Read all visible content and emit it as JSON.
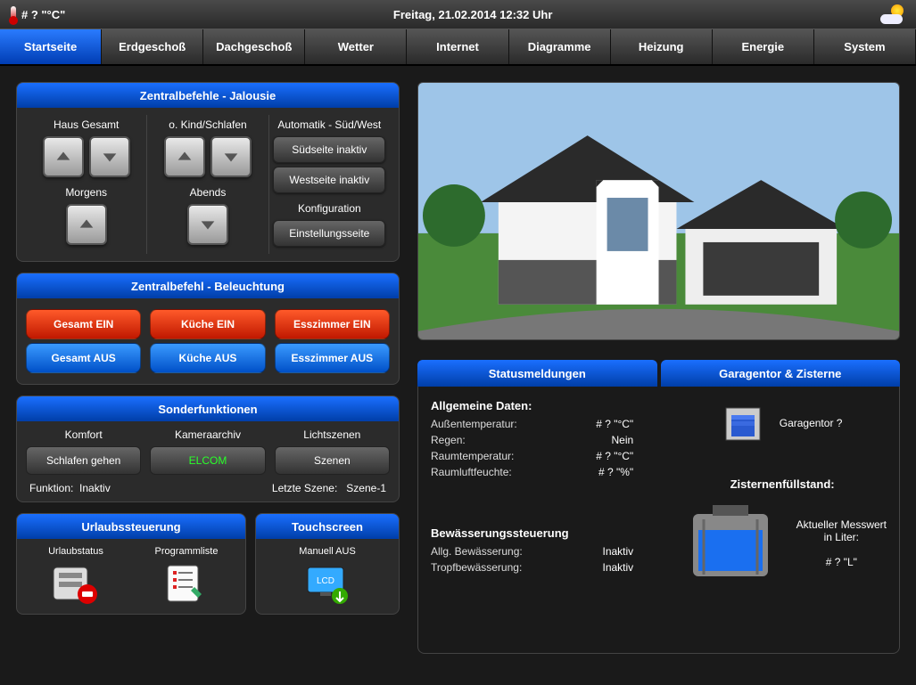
{
  "topbar": {
    "temp": "# ? \"°C\"",
    "datetime": "Freitag, 21.02.2014 12:32 Uhr"
  },
  "nav": [
    "Startseite",
    "Erdgeschoß",
    "Dachgeschoß",
    "Wetter",
    "Internet",
    "Diagramme",
    "Heizung",
    "Energie",
    "System"
  ],
  "active_nav_index": 0,
  "jalousie": {
    "title": "Zentralbefehle - Jalousie",
    "haus_label": "Haus Gesamt",
    "kind_label": "o. Kind/Schlafen",
    "morgens_label": "Morgens",
    "abends_label": "Abends",
    "auto_title": "Automatik - Süd/West",
    "sued_btn": "Südseite inaktiv",
    "west_btn": "Westseite inaktiv",
    "config_title": "Konfiguration",
    "config_btn": "Einstellungsseite"
  },
  "beleuchtung": {
    "title": "Zentralbefehl - Beleuchtung",
    "on": [
      "Gesamt EIN",
      "Küche EIN",
      "Esszimmer EIN"
    ],
    "off": [
      "Gesamt AUS",
      "Küche AUS",
      "Esszimmer AUS"
    ]
  },
  "sonder": {
    "title": "Sonderfunktionen",
    "cols": [
      "Komfort",
      "Kameraarchiv",
      "Lichtszenen"
    ],
    "btns": [
      "Schlafen gehen",
      "ELCOM",
      "Szenen"
    ],
    "func_label": "Funktion:",
    "func_value": "Inaktiv",
    "scene_label": "Letzte Szene:",
    "scene_value": "Szene-1"
  },
  "urlaub": {
    "title": "Urlaubssteuerung",
    "items": [
      "Urlaubstatus",
      "Programmliste"
    ]
  },
  "touch": {
    "title": "Touchscreen",
    "item": "Manuell AUS"
  },
  "status": {
    "tab1": "Statusmeldungen",
    "tab2": "Garagentor & Zisterne",
    "allgemein_title": "Allgemeine Daten:",
    "allgemein": [
      {
        "k": "Außentemperatur:",
        "v": "# ? \"°C\""
      },
      {
        "k": "Regen:",
        "v": "Nein"
      },
      {
        "k": "Raumtemperatur:",
        "v": "# ? \"°C\""
      },
      {
        "k": "Raumluftfeuchte:",
        "v": "# ? \"%\""
      }
    ],
    "bewaesserung_title": "Bewässerungssteuerung",
    "bewaesserung": [
      {
        "k": "Allg. Bewässerung:",
        "v": "Inaktiv"
      },
      {
        "k": "Tropfbewässerung:",
        "v": "Inaktiv"
      }
    ],
    "garage_label": "Garagentor ?",
    "zisterne_title": "Zisternenfüllstand:",
    "zisterne_label1": "Aktueller Messwert",
    "zisterne_label2": "in Liter:",
    "zisterne_value": "# ? \"L\""
  }
}
